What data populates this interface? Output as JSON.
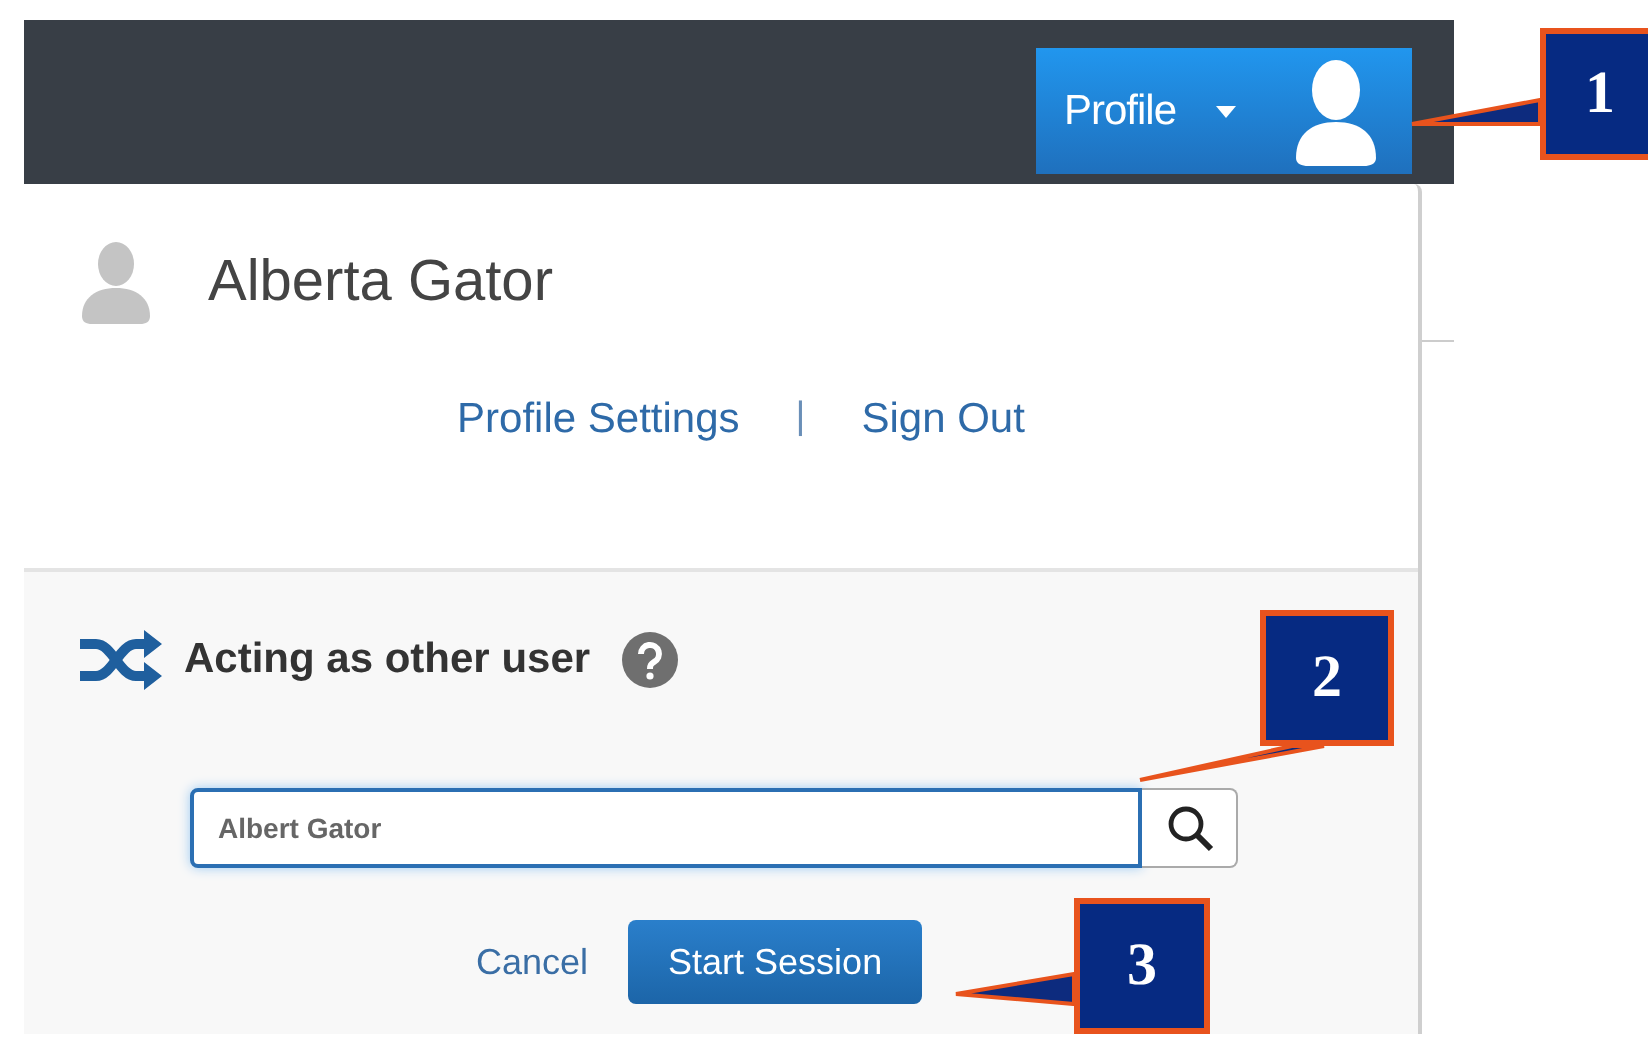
{
  "top_bar": {
    "profile_button": {
      "label": "Profile"
    }
  },
  "dropdown": {
    "user_name": "Alberta Gator",
    "links": [
      "Profile Settings",
      "Sign Out"
    ],
    "separator": "|",
    "act_as": {
      "title": "Acting as other user",
      "search": {
        "value": "Albert Gator"
      },
      "cancel": "Cancel",
      "start": "Start Session"
    }
  },
  "callouts": [
    "1",
    "2",
    "3"
  ]
}
